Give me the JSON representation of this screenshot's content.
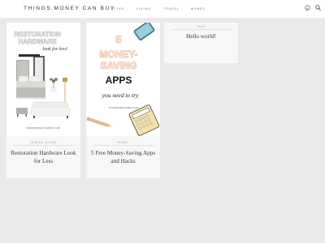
{
  "header": {
    "logo": "THINGS.MONEY CAN BUY",
    "nav": [
      "STYLE",
      "LIVING",
      "TRAVEL",
      "MONEY"
    ],
    "icons": [
      "pinterest-icon",
      "search-icon"
    ]
  },
  "posts": [
    {
      "category": "DESIGN, LIVING",
      "title": "Restoration Hardware Look for Less",
      "image_text": {
        "line1": "RESTORATION",
        "line2": "HARDWARE",
        "script": "look for less!",
        "site": "THINGSMONEYCANBUY.COM"
      }
    },
    {
      "category": "MONEY",
      "title": "5 Free Money-Saving Apps and Hacks",
      "image_text": {
        "line1": "5",
        "line2": "MONEY-",
        "line3": "SAVING",
        "line4": "APPS",
        "script": "you need to try",
        "site": "THINGSMONEYCANBUY.COM"
      }
    },
    {
      "category": "TAGS",
      "title": "Hello world!"
    }
  ],
  "colors": {
    "page_bg": "#e9e9e9",
    "card_bg": "#f7f7f7",
    "text": "#3a3a3a",
    "accent_outline": "#f0ccb5"
  }
}
